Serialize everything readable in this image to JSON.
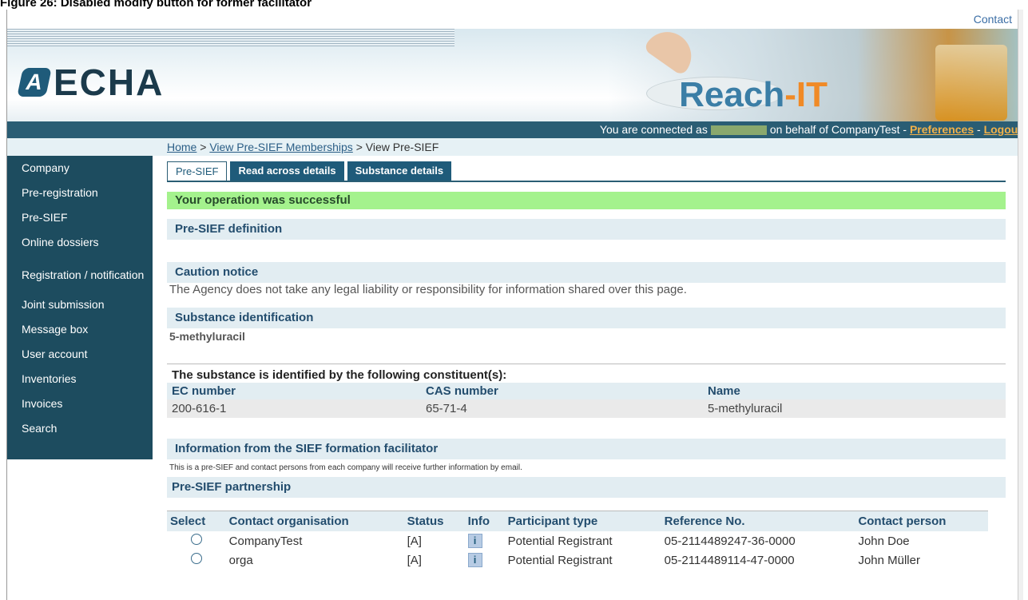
{
  "figure_caption": "Figure 26: Disabled modify button for former facilitator",
  "topbar": {
    "contact_label": "Contact"
  },
  "logo": {
    "badge": "A",
    "text": "ECHA"
  },
  "banner": {
    "reach_part1": "Reach",
    "reach_part2": "-IT"
  },
  "status": {
    "prefix": "You are connected as",
    "middle": "on behalf of CompanyTest -",
    "preferences": "Preferences",
    "sep": "-",
    "logout": "Logout"
  },
  "breadcrumb": {
    "home": "Home",
    "sep1": ">",
    "view_memberships": "View Pre-SIEF Memberships",
    "sep2": ">",
    "current": "View Pre-SIEF"
  },
  "sidebar": {
    "items": [
      "Company",
      "Pre-registration",
      "Pre-SIEF",
      "Online dossiers",
      "Registration / notification",
      "Joint submission",
      "Message box",
      "User account",
      "Inventories",
      "Invoices",
      "Search"
    ]
  },
  "tabs": [
    "Pre-SIEF",
    "Read across details",
    "Substance details"
  ],
  "success_message": "Your operation was successful",
  "sections": {
    "definition": "Pre-SIEF definition",
    "caution": "Caution notice",
    "caution_text": "The Agency does not take any legal liability or responsibility for information shared over this page.",
    "substance_id": "Substance identification",
    "substance_name": "5-methyluracil",
    "constituents_title": "The substance is identified by the following constituent(s):",
    "facilitator": "Information from the SIEF formation facilitator",
    "facilitator_text": "This is a pre-SIEF and contact persons from each company will receive further information by email.",
    "partnership": "Pre-SIEF partnership"
  },
  "constituents": {
    "headers": [
      "EC number",
      "CAS number",
      "Name"
    ],
    "rows": [
      [
        "200-616-1",
        "65-71-4",
        "5-methyluracil"
      ]
    ]
  },
  "partnership": {
    "headers": [
      "Select",
      "Contact organisation",
      "Status",
      "Info",
      "Participant type",
      "Reference No.",
      "Contact person"
    ],
    "rows": [
      {
        "org": "CompanyTest",
        "status": "[A]",
        "info": "i",
        "type": "Potential Registrant",
        "ref": "05-2114489247-36-0000",
        "person": "John Doe"
      },
      {
        "org": "orga",
        "status": "[A]",
        "info": "i",
        "type": "Potential Registrant",
        "ref": "05-2114489114-47-0000",
        "person": "John Müller"
      }
    ]
  },
  "colors": {
    "sidebar": "#1d4c5f",
    "success": "#a4f28d",
    "section": "#e2edf2",
    "accent_link": "#f0b14a"
  }
}
